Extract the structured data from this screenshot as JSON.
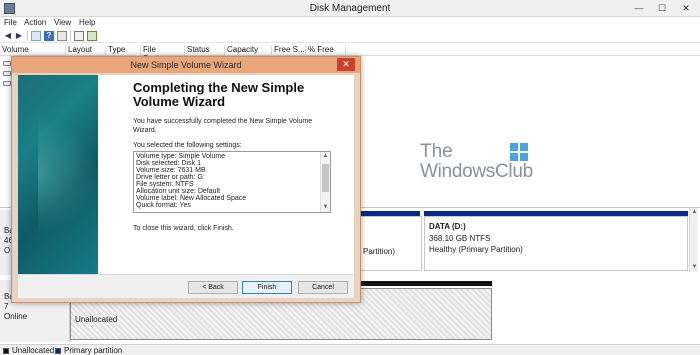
{
  "window": {
    "title": "Disk Management",
    "minimize": "—",
    "maximize": "☐",
    "close": "✕"
  },
  "menu": [
    "File",
    "Action",
    "View",
    "Help"
  ],
  "toolbar_icons": [
    "back-icon",
    "forward-icon",
    "properties-icon",
    "help-icon",
    "refresh-icon",
    "settings-icon"
  ],
  "columns": [
    "Volume",
    "Layout",
    "Type",
    "File System",
    "Status",
    "Capacity",
    "Free S...",
    "% Free"
  ],
  "disks": [
    {
      "label_lines": [
        "Ba",
        "46",
        "O"
      ]
    },
    {
      "label_lines": [
        "Ba",
        "7",
        "Online"
      ],
      "unallocated_label": "Unallocated"
    }
  ],
  "partitions": {
    "data": {
      "name": "DATA  (D:)",
      "size": "368.10 GB NTFS",
      "status": "Healthy (Primary Partition)"
    },
    "left_partial": "Partition)"
  },
  "legend": {
    "unallocated": "Unallocated",
    "primary": "Primary partition"
  },
  "watermark": {
    "line1": "The",
    "line2": "WindowsClub"
  },
  "wizard": {
    "title": "New Simple Volume Wizard",
    "close": "✕",
    "heading": "Completing the New Simple Volume Wizard",
    "intro": "You have successfully completed the New Simple Volume Wizard.",
    "settings_label": "You selected the following settings:",
    "settings": [
      "Volume type: Simple Volume",
      "Disk selected: Disk 1",
      "Volume size: 7631 MB",
      "Drive letter or path: G:",
      "File system: NTFS",
      "Allocation unit size: Default",
      "Volume label: New Allocated Space",
      "Quick format: Yes"
    ],
    "close_text": "To close this wizard, click Finish.",
    "buttons": {
      "back": "< Back",
      "finish": "Finish",
      "cancel": "Cancel"
    }
  },
  "colors": {
    "wizard_title": "#e9a67a",
    "primary_bar": "#0a2a8a",
    "close_red": "#c9412f"
  }
}
